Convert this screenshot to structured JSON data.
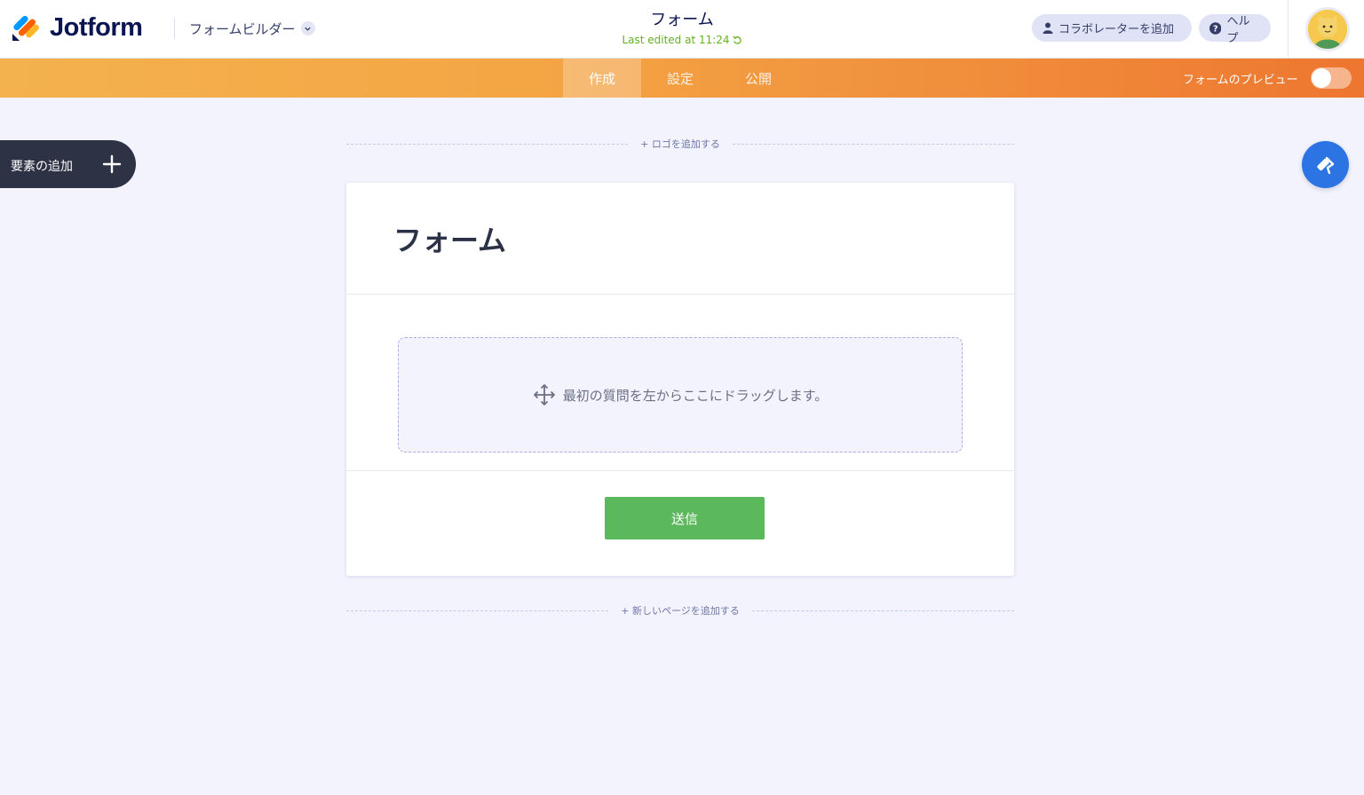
{
  "header": {
    "logo_text": "Jotform",
    "builder_label": "フォームビルダー",
    "form_title": "フォーム",
    "last_edited": "Last edited at 11:24",
    "collab_label": "コラボレーターを追加",
    "help_label": "ヘルプ"
  },
  "nav": {
    "tabs": [
      "作成",
      "設定",
      "公開"
    ],
    "active_tab": "作成",
    "preview_label": "フォームのプレビュー",
    "preview_on": false
  },
  "sidebar": {
    "add_element_label": "要素の追加"
  },
  "canvas": {
    "add_logo_label": "+ ロゴを追加する",
    "add_page_label": "+ 新しいページを追加する",
    "form_heading": "フォーム",
    "dropzone_text": "最初の質問を左からここにドラッグします。",
    "submit_label": "送信"
  },
  "colors": {
    "accent_orange": "#f08f3c",
    "submit_green": "#5cb85c",
    "designer_blue": "#2c73e4",
    "last_edited_green": "#64b21f"
  },
  "icons": {
    "logo": "jotform-logo-icon",
    "dropdown": "chevron-down-icon",
    "refresh": "refresh-icon",
    "user": "user-icon",
    "help": "question-icon",
    "plus": "plus-icon",
    "move": "move-icon",
    "designer": "paint-roller-icon"
  }
}
